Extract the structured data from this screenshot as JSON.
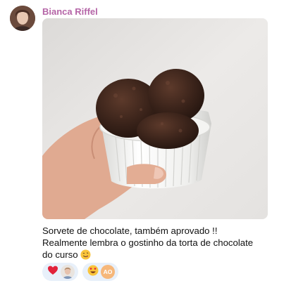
{
  "post": {
    "author": "Bianca Riffel",
    "avatar_icon": "user-photo-avatar",
    "image_icon": "chocolate-ice-cream-photo",
    "message_lines": [
      "Sorvete de chocolate, também aprovado !!",
      "Realmente lembra o gostinho da torta de chocolate",
      "do curso"
    ],
    "message_emoji": "yum-face-emoji"
  },
  "reactions": [
    {
      "emoji": "red-heart",
      "reactor": "user-photo-avatar"
    },
    {
      "emoji": "heart-eyes-face",
      "reactor_initials": "AO"
    }
  ],
  "colors": {
    "author_name": "#b565a7",
    "reaction_bg": "#e8f0fa",
    "initials_avatar_bg": "#f6b77a",
    "text": "#111111"
  }
}
